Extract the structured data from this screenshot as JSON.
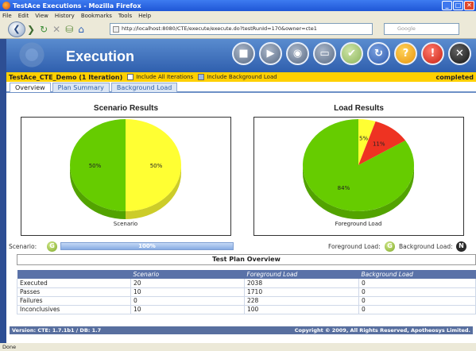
{
  "window": {
    "title": "TestAce Executions - Mozilla Firefox"
  },
  "menu": [
    "File",
    "Edit",
    "View",
    "History",
    "Bookmarks",
    "Tools",
    "Help"
  ],
  "address": {
    "url": "http://localhost:8080/CTE/execute/execute.do?testRunId=170&owner=cte1",
    "search_placeholder": "Google"
  },
  "app": {
    "title": "Execution"
  },
  "infobar": {
    "project": "TestAce_CTE_Demo (1 Iteration)",
    "include_all_iterations": "Include All Iterations",
    "include_background_load": "Include Background Load",
    "status": "completed"
  },
  "tabs": [
    {
      "label": "Overview",
      "active": true
    },
    {
      "label": "Plan Summary",
      "active": false
    },
    {
      "label": "Background Load",
      "active": false
    }
  ],
  "scenario_chart": {
    "title": "Scenario Results",
    "caption": "Scenario"
  },
  "load_chart": {
    "title": "Load Results",
    "caption": "Foreground Load"
  },
  "chart_data": [
    {
      "type": "pie",
      "title": "Scenario Results",
      "slices": [
        {
          "label": "50%",
          "value": 50,
          "color": "#ffff33"
        },
        {
          "label": "50%",
          "value": 50,
          "color": "#66cc00"
        }
      ]
    },
    {
      "type": "pie",
      "title": "Load Results",
      "slices": [
        {
          "label": "5%",
          "value": 5,
          "color": "#ffff33"
        },
        {
          "label": "11%",
          "value": 11,
          "color": "#ee3322"
        },
        {
          "label": "84%",
          "value": 84,
          "color": "#66cc00"
        }
      ]
    }
  ],
  "progress": {
    "label": "Scenario:",
    "icon": "G",
    "value": 100,
    "text": "100%"
  },
  "load_legend": {
    "foreground": "Foreground Load:",
    "background": "Background Load:",
    "fg_icon": "G",
    "bg_icon": "N"
  },
  "overview": {
    "title": "Test Plan Overview",
    "columns": [
      "",
      "Scenario",
      "Foreground Load",
      "Background Load"
    ],
    "rows": [
      [
        "Executed",
        "20",
        "2038",
        "0"
      ],
      [
        "Passes",
        "10",
        "1710",
        "0"
      ],
      [
        "Failures",
        "0",
        "228",
        "0"
      ],
      [
        "Inconclusives",
        "10",
        "100",
        "0"
      ]
    ]
  },
  "footer": {
    "version": "Version: CTE: 1.7.1b1 / DB: 1.7",
    "copyright": "Copyright © 2009, All Rights Reserved, Apotheosys Limited."
  },
  "statusbar": {
    "text": "Done"
  },
  "colors": {
    "brand_blue": "#2f5fae",
    "status_yellow": "#ffd000",
    "pie_green": "#66cc00",
    "pie_yellow": "#ffff33",
    "pie_red": "#ee3322"
  }
}
